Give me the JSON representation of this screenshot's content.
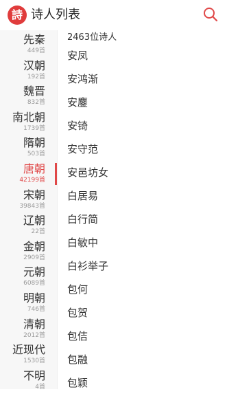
{
  "header": {
    "logo_text": "詩",
    "title": "诗人列表",
    "accent_color": "#e04848",
    "search_icon": "search-icon"
  },
  "dynasties": [
    {
      "name": "先秦",
      "count": "449首",
      "active": false
    },
    {
      "name": "汉朝",
      "count": "192首",
      "active": false
    },
    {
      "name": "魏晋",
      "count": "832首",
      "active": false
    },
    {
      "name": "南北朝",
      "count": "1739首",
      "active": false
    },
    {
      "name": "隋朝",
      "count": "503首",
      "active": false
    },
    {
      "name": "唐朝",
      "count": "42199首",
      "active": true
    },
    {
      "name": "宋朝",
      "count": "39843首",
      "active": false
    },
    {
      "name": "辽朝",
      "count": "22首",
      "active": false
    },
    {
      "name": "金朝",
      "count": "2909首",
      "active": false
    },
    {
      "name": "元朝",
      "count": "6089首",
      "active": false
    },
    {
      "name": "明朝",
      "count": "746首",
      "active": false
    },
    {
      "name": "清朝",
      "count": "2012首",
      "active": false
    },
    {
      "name": "近现代",
      "count": "1530首",
      "active": false
    },
    {
      "name": "不明",
      "count": "4首",
      "active": false
    }
  ],
  "poet_list": {
    "count_label": "2463位诗人",
    "poets": [
      "安凤",
      "安鸿渐",
      "安鏖",
      "安锜",
      "安守范",
      "安邑坊女",
      "白居易",
      "白行简",
      "白敏中",
      "白衫举子",
      "包何",
      "包贺",
      "包佶",
      "包融",
      "包颖"
    ]
  }
}
